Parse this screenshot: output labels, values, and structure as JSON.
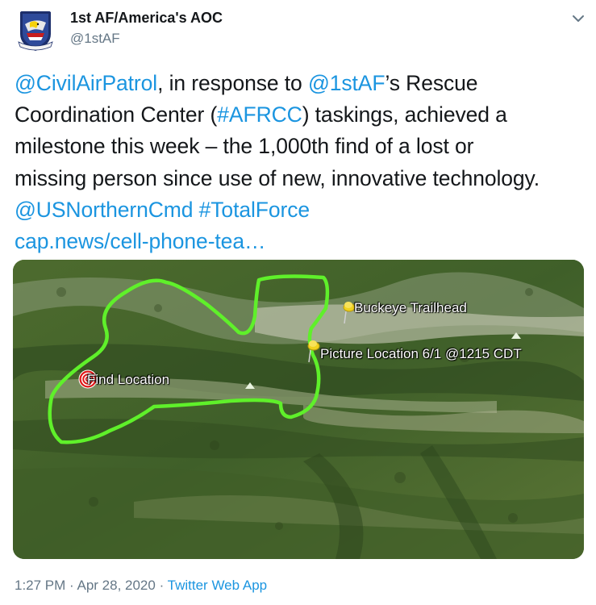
{
  "author": {
    "display_name": "1st AF/America's AOC",
    "handle": "@1stAF",
    "avatar_icon": "air-force-emblem-icon"
  },
  "menu": {
    "icon": "chevron-down-icon"
  },
  "tweet": {
    "line1": {
      "mention1": "@CivilAirPatrol",
      "t1": ", in response to ",
      "mention2": "@1stAF",
      "t2": "’s Rescue"
    },
    "line2": {
      "t1": "Coordination Center (",
      "hashtag": "#AFRCC",
      "t2": ") taskings, achieved a"
    },
    "line3": {
      "t1": "milestone this week – the 1,000th find of a lost or"
    },
    "line4": {
      "t1": "missing person since use of new, innovative technology."
    },
    "line5": {
      "mention": "@USNorthernCmd",
      "space": " ",
      "hashtag": "#TotalForce"
    },
    "line6": {
      "link": "cap.news/cell-phone-tea…"
    }
  },
  "map": {
    "labels": {
      "trailhead": "Buckeye Trailhead",
      "picture_location": "Picture Location 6/1 @1215 CDT",
      "find_location": "Find Location"
    },
    "colors": {
      "search_area": "#5ff02a",
      "pin": "#f0d21e",
      "target": "#e01818"
    }
  },
  "meta": {
    "time": "1:27 PM",
    "sep1": " · ",
    "date": "Apr 28, 2020",
    "sep2": " · ",
    "source": "Twitter Web App"
  },
  "colors": {
    "link": "#1b95e0",
    "secondary_text": "#657786"
  }
}
